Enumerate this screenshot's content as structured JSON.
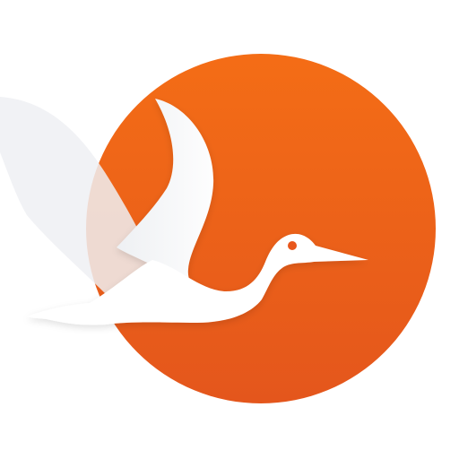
{
  "app_icon": {
    "name": "",
    "colors": {
      "background": "#ffffff",
      "circle_top": "#f36a17",
      "circle_bottom": "#e85a1b",
      "bird": "#ffffff",
      "bird_shadow": "#e9e9ec",
      "eye": "#e8571c"
    },
    "icons": {
      "emblem": "crane-in-sun-logo",
      "disc": "orange-sun-disc-icon",
      "bird": "crane-bird-icon"
    }
  }
}
